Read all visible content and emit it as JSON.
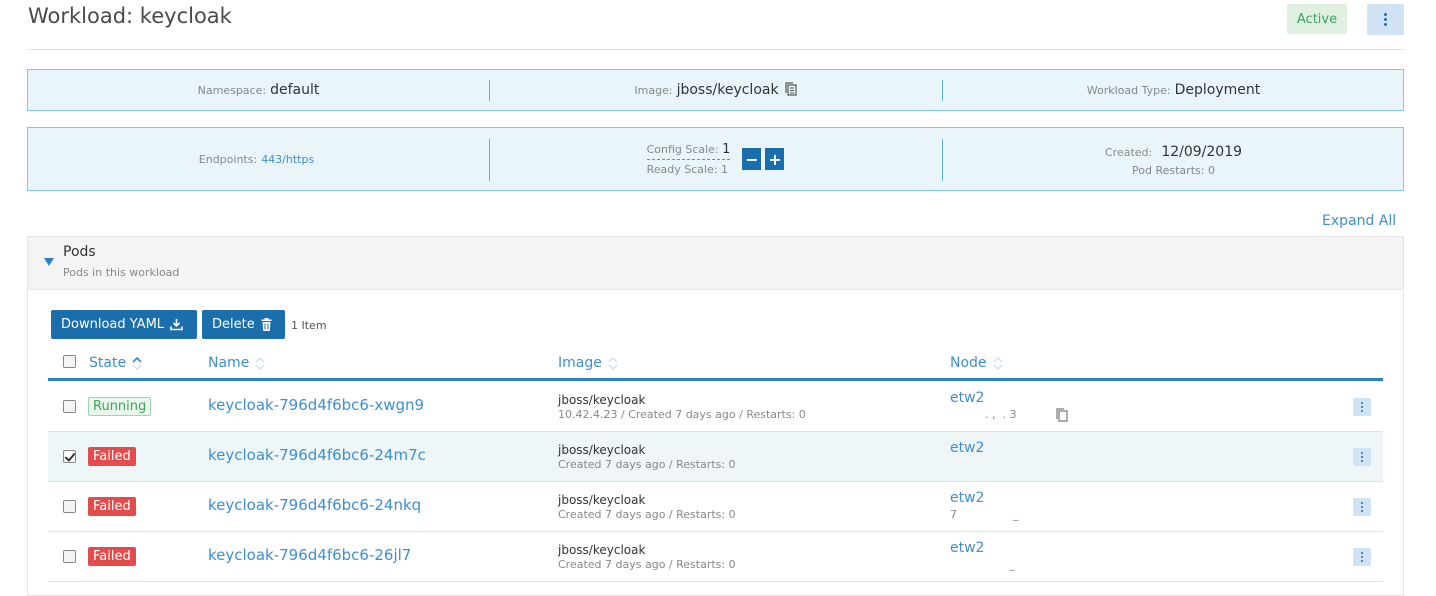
{
  "header": {
    "title": "Workload: keycloak",
    "state": "Active"
  },
  "info": {
    "namespace_label": "Namespace:",
    "namespace": "default",
    "image_label": "Image:",
    "image": "jboss/keycloak",
    "workload_type_label": "Workload Type:",
    "workload_type": "Deployment",
    "endpoints_label": "Endpoints:",
    "endpoints": "443/https",
    "config_scale_label": "Config Scale:",
    "config_scale": "1",
    "ready_scale_label": "Ready Scale:",
    "ready_scale": "1",
    "decrease_label": "−",
    "increase_label": "+",
    "created_label": "Created:",
    "created": "12/09/2019",
    "pod_restarts_label": "Pod Restarts:",
    "pod_restarts": "0"
  },
  "expand_all": "Expand All",
  "pods": {
    "title": "Pods",
    "subtitle": "Pods in this workload",
    "download_yaml": "Download YAML",
    "delete": "Delete",
    "item_count": "1 Item",
    "columns": {
      "state": "State",
      "name": "Name",
      "image": "Image",
      "node": "Node"
    },
    "rows": [
      {
        "state": "Running",
        "name": "keycloak-796d4f6bc6-xwgn9",
        "image": "jboss/keycloak",
        "detail": "10.42.4.23 / Created 7 days ago / Restarts: 0",
        "node": "etw2",
        "node_sub": "          . ,  . 3",
        "checked": false
      },
      {
        "state": "Failed",
        "name": "keycloak-796d4f6bc6-24m7c",
        "image": "jboss/keycloak",
        "detail": "Created 7 days ago / Restarts: 0",
        "node": "etw2",
        "node_sub": "",
        "checked": true
      },
      {
        "state": "Failed",
        "name": "keycloak-796d4f6bc6-24nkq",
        "image": "jboss/keycloak",
        "detail": "Created 7 days ago / Restarts: 0",
        "node": "etw2",
        "node_sub": "7                _",
        "checked": false
      },
      {
        "state": "Failed",
        "name": "keycloak-796d4f6bc6-26jl7",
        "image": "jboss/keycloak",
        "detail": "Created 7 days ago / Restarts: 0",
        "node": "etw2",
        "node_sub": "                 _",
        "checked": false
      }
    ]
  },
  "colors": {
    "accent": "#1a6eab",
    "link": "#3d8fd1",
    "running": "#3ba55c",
    "failed": "#e34c4c",
    "info_bg": "#e9f5f8"
  },
  "icons": [
    "kebab-icon",
    "copy-icon",
    "caret-down-icon",
    "download-icon",
    "trash-icon",
    "sort-icon"
  ]
}
